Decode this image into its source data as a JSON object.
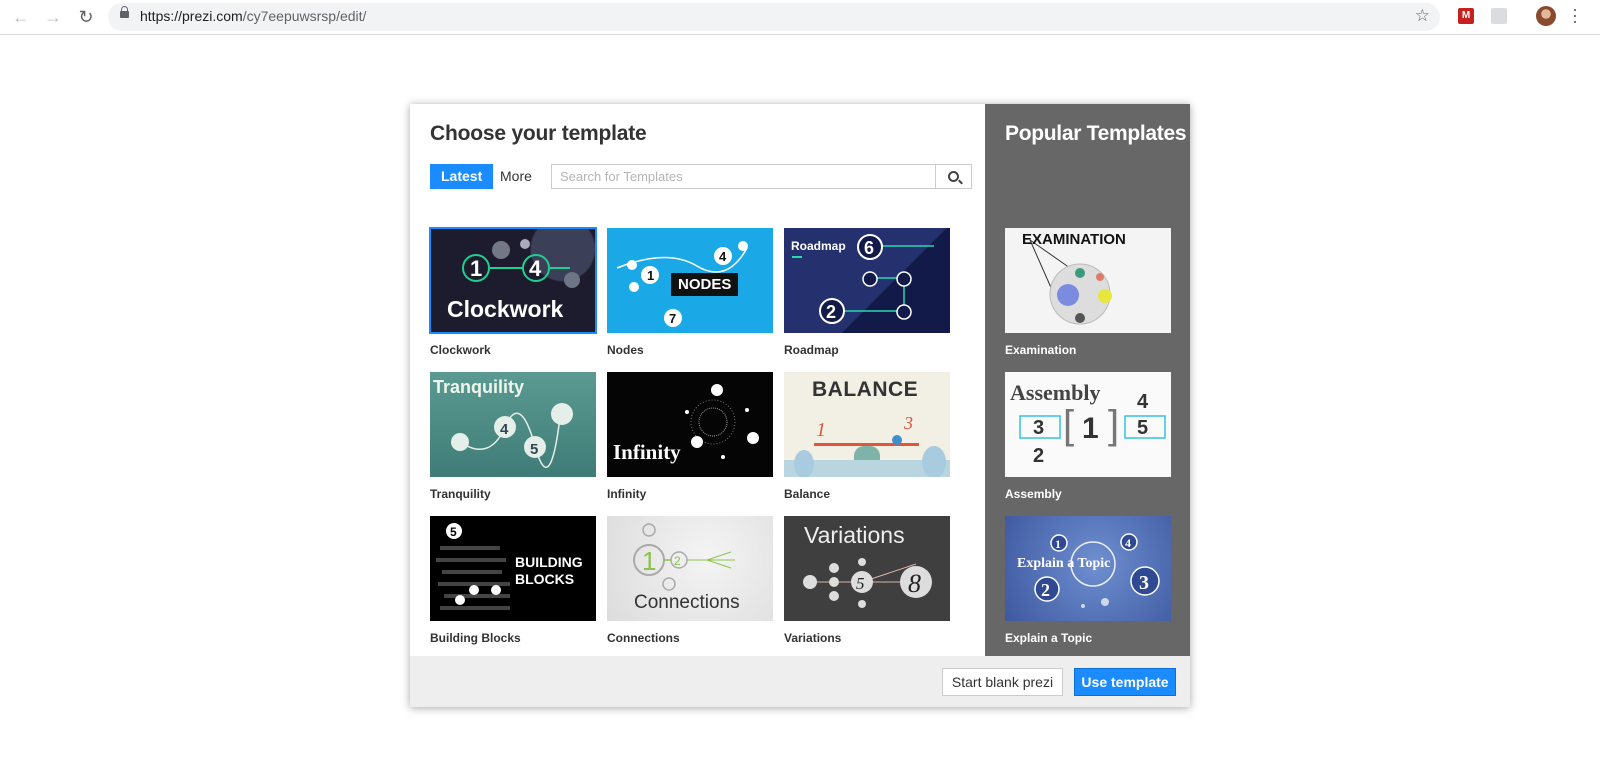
{
  "browser": {
    "url_host": "https://prezi.com",
    "url_path": "/cy7eepuwsrsp/edit/",
    "extension_m_label": "M"
  },
  "dialog": {
    "title": "Choose your template",
    "tabs": [
      "Latest",
      "More"
    ],
    "active_tab": "Latest",
    "search_placeholder": "Search for Templates",
    "search_value": "",
    "templates": [
      {
        "label": "Clockwork",
        "thumb_text": "Clockwork",
        "selected": true
      },
      {
        "label": "Nodes",
        "thumb_text": "NODES"
      },
      {
        "label": "Roadmap",
        "thumb_text": "Roadmap"
      },
      {
        "label": "Tranquility",
        "thumb_text": "Tranquility"
      },
      {
        "label": "Infinity",
        "thumb_text": "Infinity"
      },
      {
        "label": "Balance",
        "thumb_text": "BALANCE"
      },
      {
        "label": "Building Blocks",
        "thumb_text": "BUILDING BLOCKS"
      },
      {
        "label": "Connections",
        "thumb_text": "Connections"
      },
      {
        "label": "Variations",
        "thumb_text": "Variations"
      }
    ],
    "popular_title": "Popular Templates",
    "popular_templates": [
      {
        "label": "Examination",
        "thumb_text": "EXAMINATION"
      },
      {
        "label": "Assembly",
        "thumb_text": "Assembly"
      },
      {
        "label": "Explain a Topic",
        "thumb_text": "Explain a Topic"
      }
    ],
    "buttons": {
      "start_blank": "Start blank prezi",
      "use_template": "Use template"
    }
  },
  "colors": {
    "accent": "#1a8cff",
    "sidebar": "#676767",
    "footer": "#eeeeee"
  }
}
